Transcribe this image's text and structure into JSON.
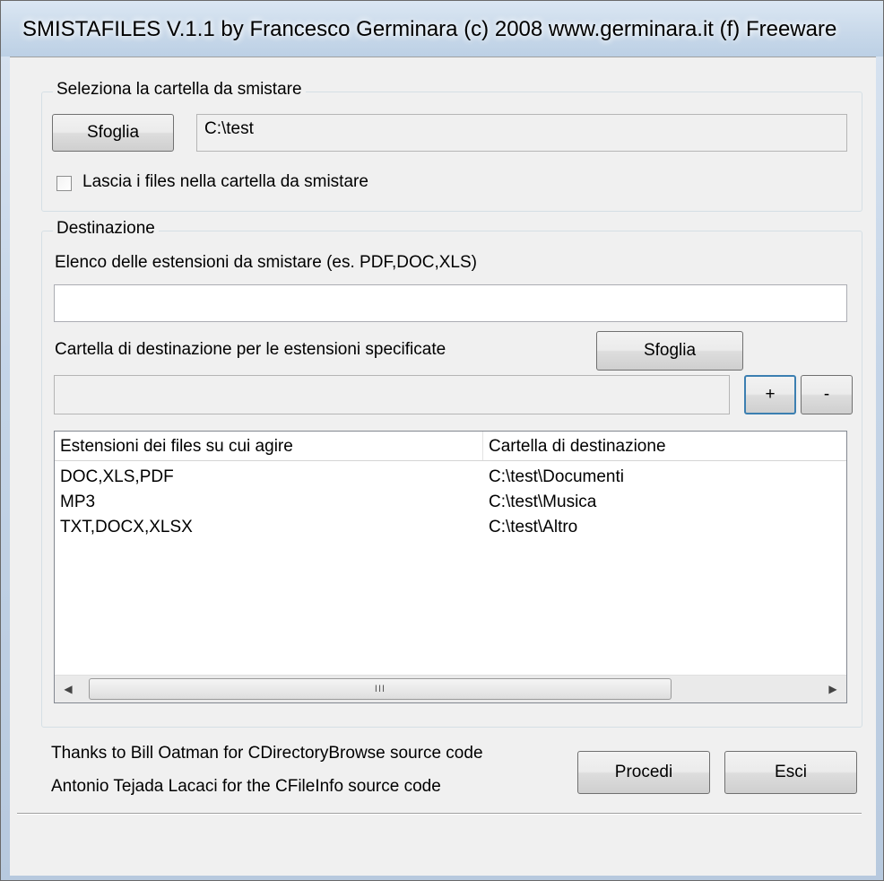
{
  "window": {
    "title": "SMISTAFILES V.1.1 by Francesco Germinara (c) 2008 www.germinara.it (f) Freeware"
  },
  "source_group": {
    "legend": "Seleziona la cartella da smistare",
    "browse_label": "Sfoglia",
    "path_value": "C:\\test",
    "checkbox_label": "Lascia i files nella cartella da smistare",
    "checkbox_checked": false
  },
  "dest_group": {
    "legend": "Destinazione",
    "ext_label": "Elenco delle estensioni da smistare (es. PDF,DOC,XLS)",
    "ext_value": "",
    "folder_label": "Cartella di destinazione per le estensioni specificate",
    "browse_label": "Sfoglia",
    "folder_value": "",
    "add_label": "+",
    "remove_label": "-"
  },
  "table": {
    "columns": [
      "Estensioni dei files su cui agire",
      "Cartella di destinazione"
    ],
    "rows": [
      [
        "DOC,XLS,PDF",
        "C:\\test\\Documenti"
      ],
      [
        "MP3",
        "C:\\test\\Musica"
      ],
      [
        "TXT,DOCX,XLSX",
        "C:\\test\\Altro"
      ]
    ],
    "scroll_thumb_glyph": "III"
  },
  "footer": {
    "credit_line_1": "Thanks to Bill Oatman for CDirectoryBrowse source code",
    "credit_line_2": "Antonio Tejada Lacaci for the  CFileInfo source code",
    "proceed_label": "Procedi",
    "exit_label": "Esci"
  },
  "colors": {
    "client_bg": "#f0f0f0",
    "frame": "#c5d5e8"
  }
}
